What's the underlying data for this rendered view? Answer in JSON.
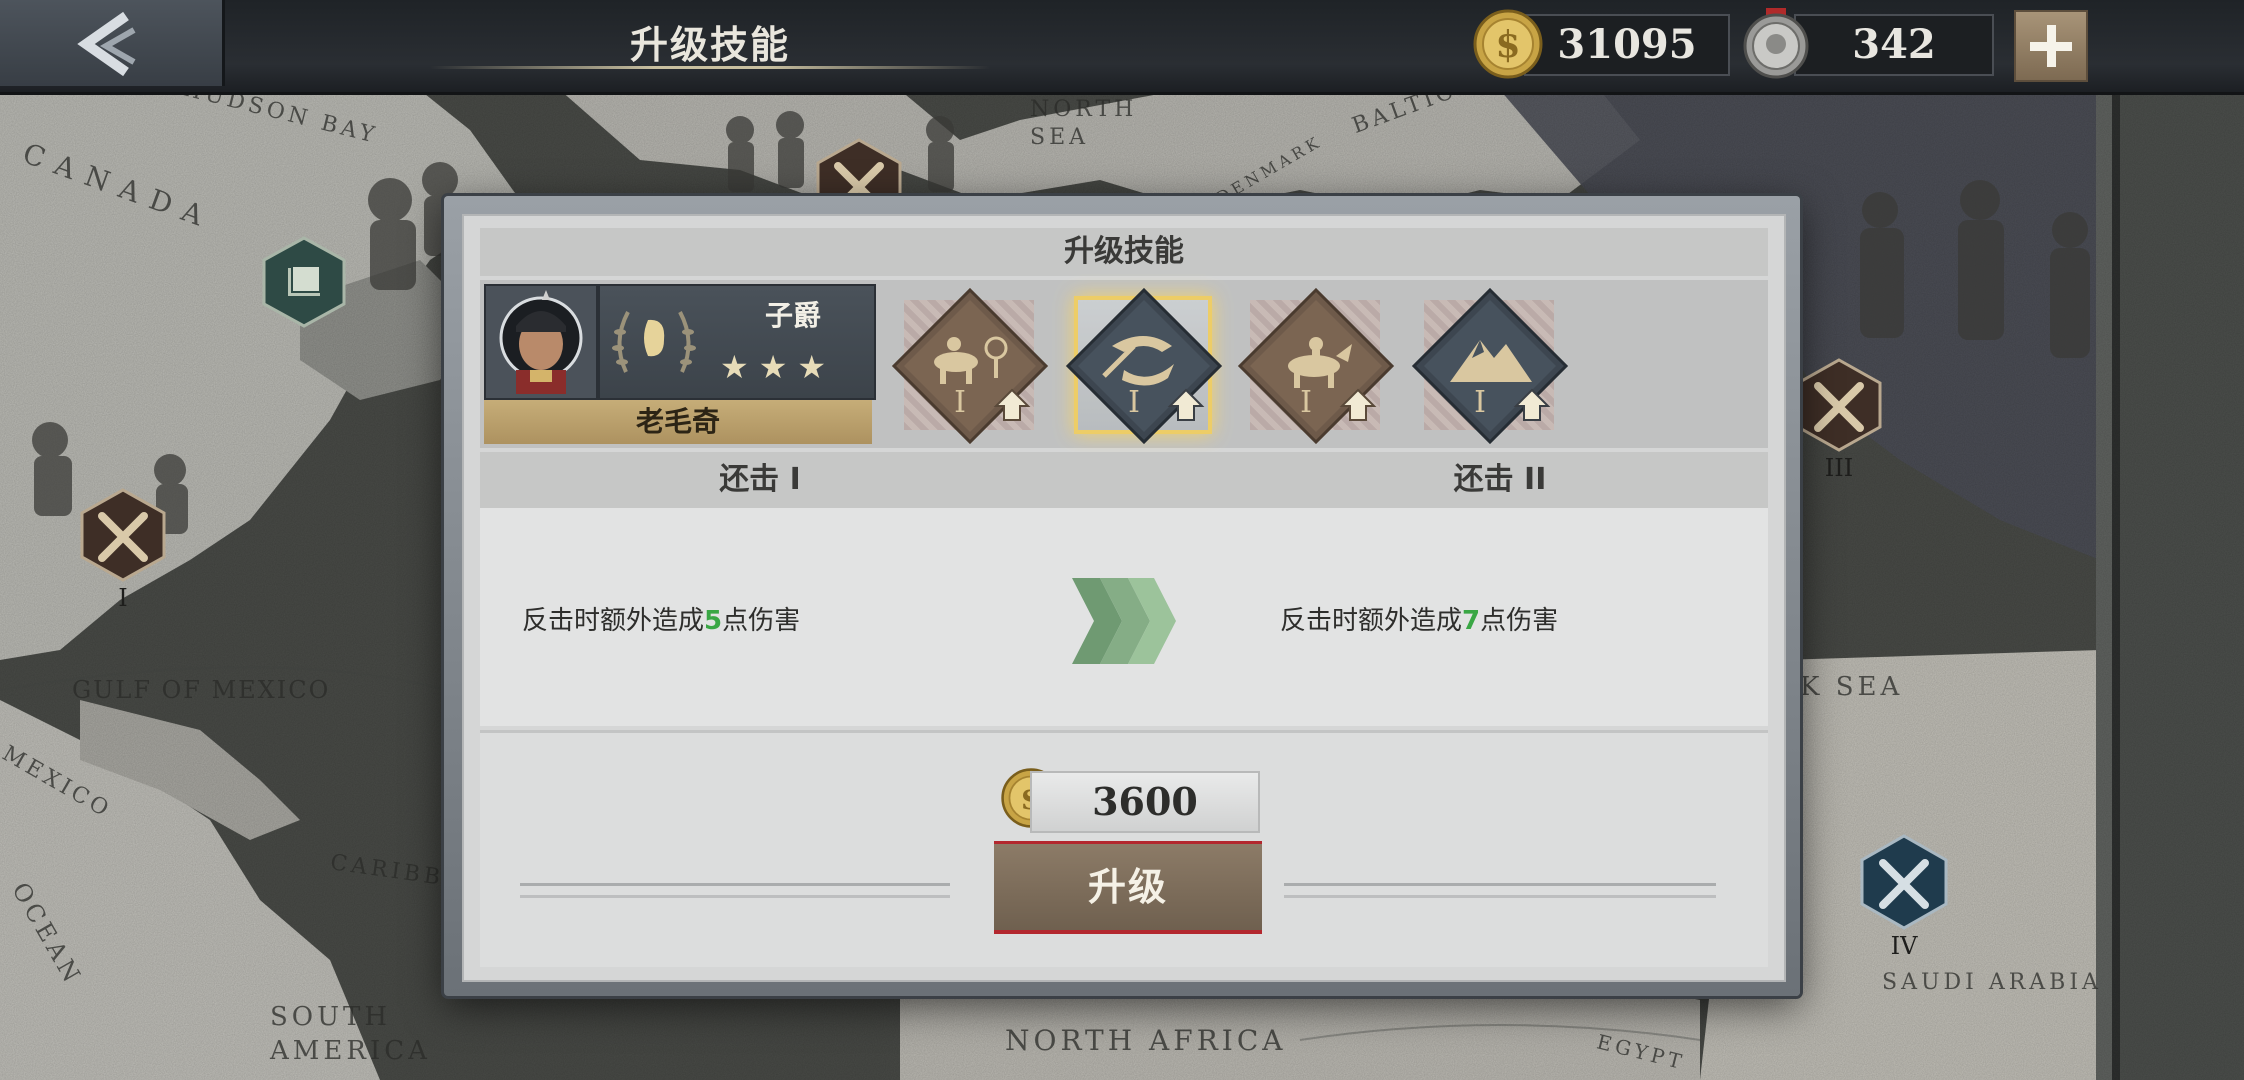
{
  "header": {
    "title": "升级技能",
    "gold_amount": "31095",
    "medal_amount": "342"
  },
  "map": {
    "labels": [
      "HUDSON BAY",
      "CANADA",
      "NORTH SEA",
      "BALTIC",
      "DENMARK",
      "GULF OF MEXICO",
      "MEXICO",
      "CARIBB",
      "OCEAN",
      "SOUTH AMERICA",
      "NORTH AFRICA",
      "EGYPT",
      "SAUDI ARABIA",
      "K SEA"
    ],
    "markers": [
      "I",
      "III",
      "IV"
    ]
  },
  "dialog": {
    "title": "升级技能",
    "general": {
      "rank": "子爵",
      "stars": 3,
      "name": "老毛奇"
    },
    "skills": [
      {
        "icon": "cavalry-target-skill-icon",
        "level": "I",
        "selected": false
      },
      {
        "icon": "counterattack-skill-icon",
        "level": "I",
        "selected": true
      },
      {
        "icon": "cavalry-charge-skill-icon",
        "level": "I",
        "selected": false
      },
      {
        "icon": "mountain-skill-icon",
        "level": "I",
        "selected": false
      }
    ],
    "current_level": "还击 I",
    "next_level": "还击 II",
    "current_desc": {
      "prefix": "反击时额外造成",
      "value": "5",
      "suffix": "点伤害"
    },
    "next_desc": {
      "prefix": "反击时额外造成",
      "value": "7",
      "suffix": "点伤害"
    },
    "cost": "3600",
    "upgrade_label": "升级"
  },
  "colors": {
    "highlight_value": "#3aa745",
    "selected_glow": "#f2cf5e",
    "button_border": "#b3272e"
  }
}
